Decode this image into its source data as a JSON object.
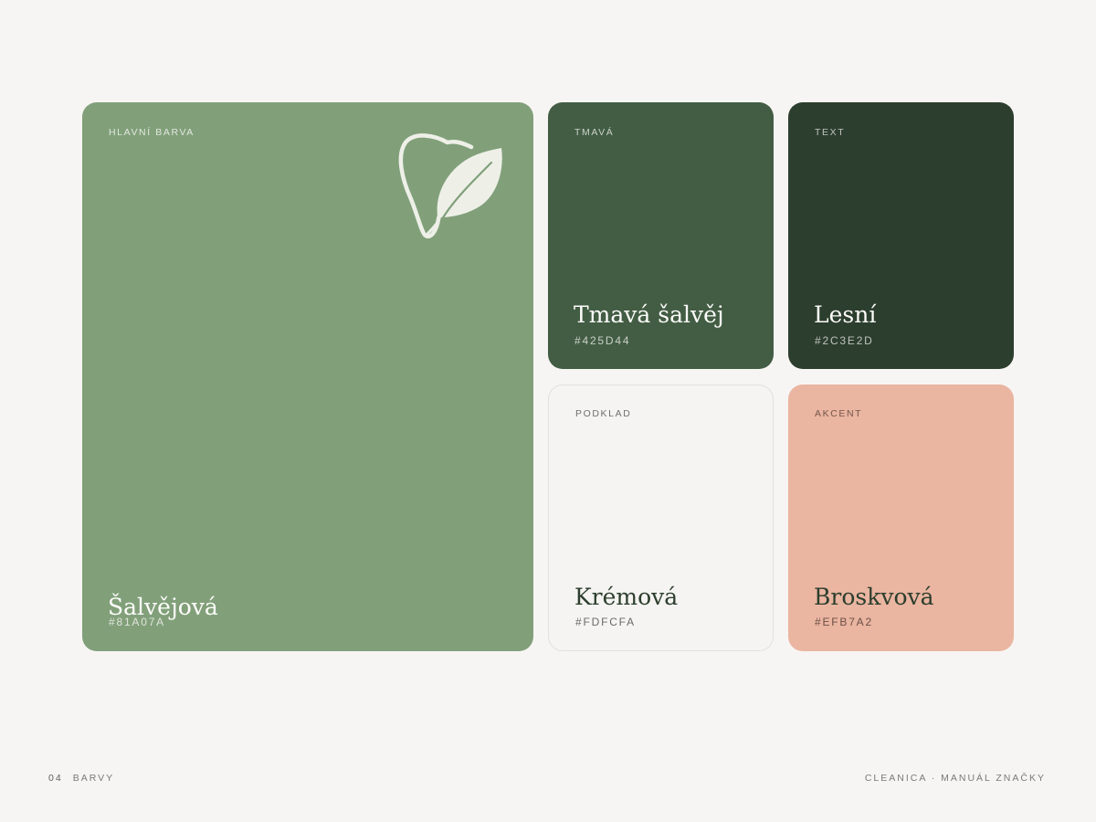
{
  "palette": [
    {
      "label": "HLAVNÍ BARVA",
      "name": "Šalvějová",
      "hex": "#81A07A",
      "color": "#81a07a"
    },
    {
      "label": "TMAVÁ",
      "name": "Tmavá šalvěj",
      "hex": "#425D44",
      "color": "#425d44"
    },
    {
      "label": "TEXT",
      "name": "Lesní",
      "hex": "#2C3E2D",
      "color": "#2c3e2d"
    },
    {
      "label": "PODKLAD",
      "name": "Krémová",
      "hex": "#FDFCFA",
      "color": "#fdfcfa"
    },
    {
      "label": "AKCENT",
      "name": "Broskvová",
      "hex": "#EFB7A2",
      "color": "#efb7a2"
    }
  ],
  "logo": {
    "icon": "tooth-leaf-icon",
    "color": "#eef0e8"
  },
  "footer": {
    "page_number": "04",
    "section": "BARVY",
    "brand": "CLEANICA · MANUÁL ZNAČKY"
  }
}
